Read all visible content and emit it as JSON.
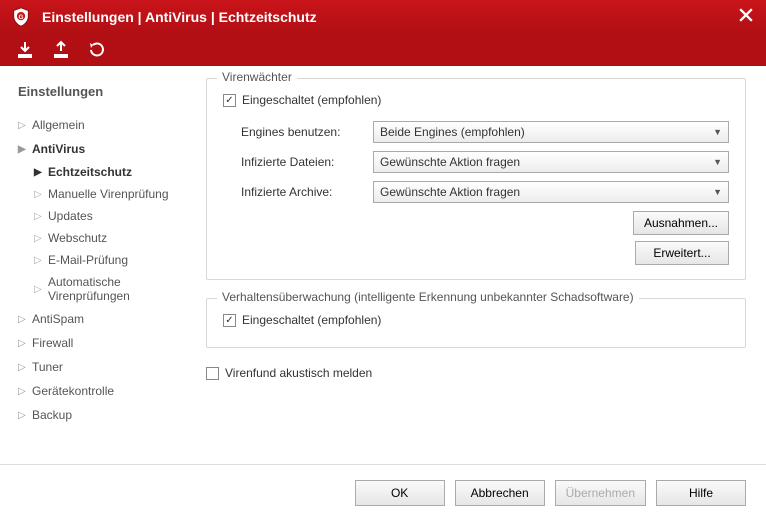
{
  "window": {
    "title": "Einstellungen | AntiVirus | Echtzeitschutz"
  },
  "sidebar": {
    "heading": "Einstellungen",
    "items": [
      {
        "label": "Allgemein"
      },
      {
        "label": "AntiVirus",
        "expanded": true,
        "children": [
          {
            "label": "Echtzeitschutz",
            "active": true
          },
          {
            "label": "Manuelle Virenprüfung"
          },
          {
            "label": "Updates"
          },
          {
            "label": "Webschutz"
          },
          {
            "label": "E-Mail-Prüfung"
          },
          {
            "label": "Automatische Virenprüfungen"
          }
        ]
      },
      {
        "label": "AntiSpam"
      },
      {
        "label": "Firewall"
      },
      {
        "label": "Tuner"
      },
      {
        "label": "Gerätekontrolle"
      },
      {
        "label": "Backup"
      }
    ]
  },
  "groups": {
    "guard": {
      "title": "Virenwächter",
      "enabled_label": "Eingeschaltet (empfohlen)",
      "enabled_checked": true,
      "rows": {
        "engines": {
          "label": "Engines benutzen:",
          "value": "Beide Engines (empfohlen)"
        },
        "infected_files": {
          "label": "Infizierte Dateien:",
          "value": "Gewünschte Aktion fragen"
        },
        "infected_archives": {
          "label": "Infizierte Archive:",
          "value": "Gewünschte Aktion fragen"
        }
      },
      "buttons": {
        "exceptions": "Ausnahmen...",
        "advanced": "Erweitert..."
      }
    },
    "behavior": {
      "title": "Verhaltensüberwachung (intelligente Erkennung unbekannter Schadsoftware)",
      "enabled_label": "Eingeschaltet (empfohlen)",
      "enabled_checked": true
    }
  },
  "acoustic": {
    "label": "Virenfund akustisch melden",
    "checked": false
  },
  "footer": {
    "ok": "OK",
    "cancel": "Abbrechen",
    "apply": "Übernehmen",
    "help": "Hilfe"
  }
}
